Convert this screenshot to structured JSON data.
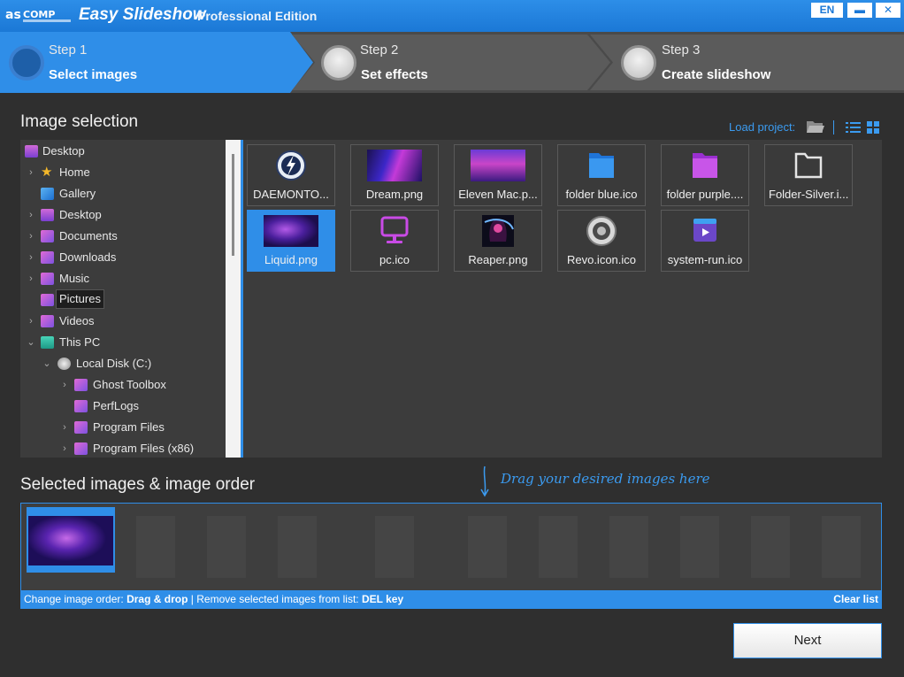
{
  "titlebar": {
    "brand_logo": "ascomp software logo",
    "app_title": "Easy Slideshow",
    "edition": "Professional Edition",
    "language": "EN",
    "minimize_glyph": "▬",
    "close_glyph": "✕"
  },
  "steps": [
    {
      "number": "Step 1",
      "name": "Select images",
      "active": true
    },
    {
      "number": "Step 2",
      "name": "Set effects",
      "active": false
    },
    {
      "number": "Step 3",
      "name": "Create slideshow",
      "active": false
    }
  ],
  "image_selection": {
    "title": "Image selection",
    "load_project": "Load project:"
  },
  "tree": {
    "items": [
      {
        "label": "Desktop",
        "icon": "desktop-icon",
        "has_chevron": false
      },
      {
        "label": "Home",
        "icon": "star-icon",
        "has_chevron": true
      },
      {
        "label": "Gallery",
        "icon": "gallery-icon",
        "has_chevron": false
      },
      {
        "label": "Desktop",
        "icon": "desktop-icon",
        "has_chevron": true
      },
      {
        "label": "Documents",
        "icon": "documents-icon",
        "has_chevron": true
      },
      {
        "label": "Downloads",
        "icon": "downloads-icon",
        "has_chevron": true
      },
      {
        "label": "Music",
        "icon": "music-icon",
        "has_chevron": true
      },
      {
        "label": "Pictures",
        "icon": "pictures-icon",
        "has_chevron": false,
        "selected": true
      },
      {
        "label": "Videos",
        "icon": "videos-icon",
        "has_chevron": true
      },
      {
        "label": "This PC",
        "icon": "this-pc-icon",
        "has_chevron": true,
        "expanded": true
      },
      {
        "label": "Local Disk (C:)",
        "icon": "disk-icon",
        "has_chevron": true,
        "expanded": true
      },
      {
        "label": "Ghost Toolbox",
        "icon": "folder-icon",
        "has_chevron": true
      },
      {
        "label": "PerfLogs",
        "icon": "folder-icon",
        "has_chevron": false
      },
      {
        "label": "Program Files",
        "icon": "folder-icon",
        "has_chevron": true
      },
      {
        "label": "Program Files (x86)",
        "icon": "folder-icon",
        "has_chevron": true
      }
    ]
  },
  "images": [
    {
      "caption": "DAEMONTO...",
      "icon": "daemon-tools-icon"
    },
    {
      "caption": "Dream.png",
      "icon": "dream-wallpaper"
    },
    {
      "caption": "Eleven Mac.p...",
      "icon": "eleven-mac-wallpaper"
    },
    {
      "caption": "folder blue.ico",
      "icon": "folder-blue-icon"
    },
    {
      "caption": "folder purple....",
      "icon": "folder-purple-icon"
    },
    {
      "caption": "Folder-Silver.i...",
      "icon": "folder-silver-icon"
    },
    {
      "caption": "Liquid.png",
      "icon": "liquid-wallpaper",
      "selected": true
    },
    {
      "caption": "pc.ico",
      "icon": "pc-icon"
    },
    {
      "caption": "Reaper.png",
      "icon": "reaper-image"
    },
    {
      "caption": "Revo.icon.ico",
      "icon": "revo-icon"
    },
    {
      "caption": "system-run.ico",
      "icon": "system-run-icon"
    }
  ],
  "selected_section": {
    "title": "Selected images & image order",
    "drag_hint": "Drag your desired images here",
    "selected_image": "Liquid.png"
  },
  "statusbar": {
    "order_label": "Change image order:",
    "order_value": "Drag & drop",
    "separator": "|",
    "remove_label": "Remove selected images from list:",
    "remove_value": "DEL key",
    "clear_list": "Clear list"
  },
  "next_button": "Next",
  "colors": {
    "accent": "#2f8ee8",
    "background": "#2f2f2f",
    "panel": "#3c3c3c",
    "step_inactive": "#4a4a4a"
  }
}
